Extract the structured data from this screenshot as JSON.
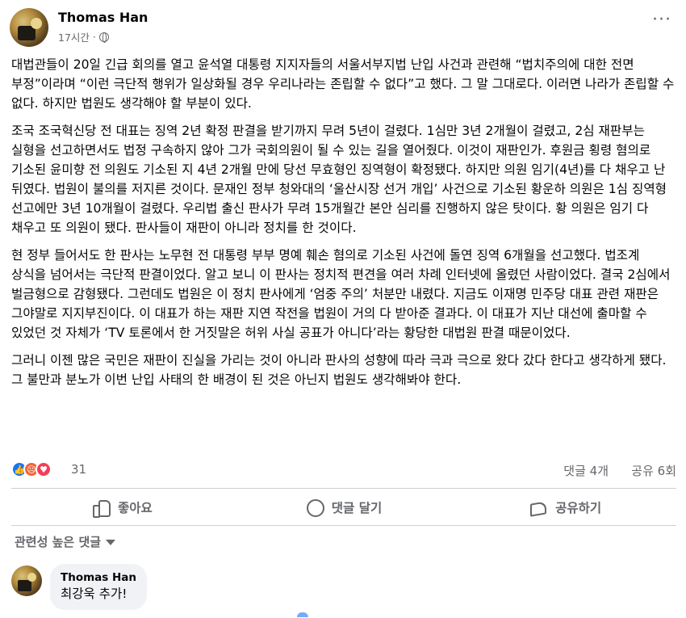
{
  "post": {
    "author": "Thomas Han",
    "time": "17시간",
    "separator": "·",
    "paragraphs": [
      "대법관들이 20일 긴급 회의를 열고 윤석열 대통령 지지자들의 서울서부지법 난입 사건과 관련해 “법치주의에 대한 전면 부정”이라며 “이런 극단적 행위가 일상화될 경우 우리나라는 존립할 수 없다”고 했다. 그 말 그대로다. 이러면 나라가 존립할 수 없다. 하지만 법원도 생각해야 할 부분이 있다.",
      "조국 조국혁신당 전 대표는 징역 2년 확정 판결을 받기까지 무려 5년이 걸렸다. 1심만 3년 2개월이 걸렸고, 2심 재판부는 실형을 선고하면서도 법정 구속하지 않아 그가 국회의원이 될 수 있는 길을 열어줬다. 이것이 재판인가. 후원금 횡령 혐의로 기소된 윤미향 전 의원도 기소된 지 4년 2개월 만에 당선 무효형인 징역형이 확정됐다. 하지만 의원 임기(4년)를 다 채우고 난 뒤였다. 법원이 불의를 저지른 것이다. 문재인 정부 청와대의 ‘울산시장 선거 개입’ 사건으로 기소된 황운하 의원은 1심 징역형 선고에만 3년 10개월이 걸렸다. 우리법 출신 판사가 무려 15개월간 본안 심리를 진행하지 않은 탓이다. 황 의원은 임기 다 채우고 또 의원이 됐다. 판사들이 재판이 아니라 정치를 한 것이다.",
      "현 정부 들어서도 한 판사는 노무현 전 대통령 부부 명예 훼손 혐의로 기소된 사건에 돌연 징역 6개월을 선고했다. 법조계 상식을 넘어서는 극단적 판결이었다. 알고 보니 이 판사는 정치적 편견을 여러 차례 인터넷에 올렸던 사람이었다. 결국 2심에서 벌금형으로 감형됐다. 그런데도 법원은 이 정치 판사에게 ‘엄중 주의’ 처분만 내렸다. 지금도 이재명 민주당 대표 관련 재판은 그야말로 지지부진이다. 이 대표가 하는 재판 지연 작전을 법원이 거의 다 받아준 결과다. 이 대표가 지난 대선에 출마할 수 있었던 것 자체가 ‘TV 토론에서 한 거짓말은 허위 사실 공표가 아니다’라는 황당한 대법원 판결 때문이었다.",
      "그러니 이젠 많은 국민은 재판이 진실을 가리는 것이 아니라 판사의 성향에 따라 극과 극으로 왔다 갔다 한다고 생각하게 됐다. 그 불만과 분노가 이번 난입 사태의 한 배경이 된 것은 아닌지 법원도 생각해봐야 한다."
    ]
  },
  "stats": {
    "reaction_count": "31",
    "comments": "댓글 4개",
    "shares": "공유 6회",
    "reaction_icons": [
      "like-icon",
      "angry-icon",
      "love-icon"
    ]
  },
  "actions": {
    "like": "좋아요",
    "comment": "댓글 달기",
    "share": "공유하기"
  },
  "comments_section": {
    "filter_label": "관련성 높은 댓글",
    "items": [
      {
        "author": "Thomas Han",
        "text": "최강욱 추가!"
      }
    ]
  }
}
